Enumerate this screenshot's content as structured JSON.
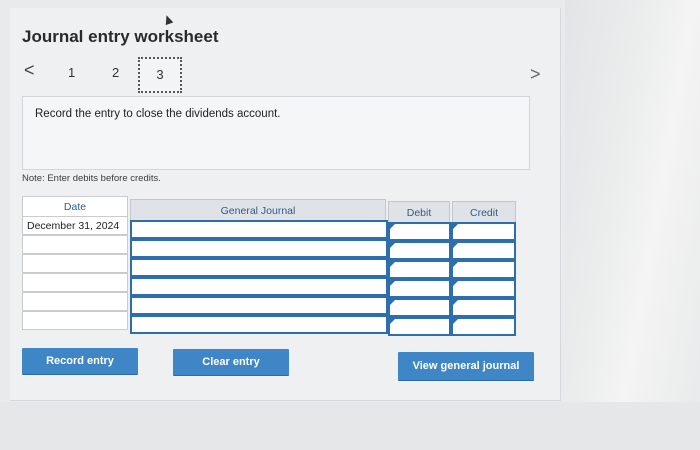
{
  "worksheet": {
    "title": "Journal entry worksheet",
    "pager": {
      "prev_icon": "chevron-left-icon",
      "next_icon": "chevron-right-icon",
      "prev_glyph": "<",
      "next_glyph": ">",
      "pages": [
        "1",
        "2",
        "3"
      ],
      "current": "3"
    },
    "instruction": "Record the entry to close the dividends account.",
    "note": "Note: Enter debits before credits."
  },
  "table": {
    "headers": {
      "date": "Date",
      "general_journal": "General Journal",
      "debit": "Debit",
      "credit": "Credit"
    },
    "rows": [
      {
        "date": "December 31, 2024",
        "account": "",
        "debit": "",
        "credit": ""
      },
      {
        "date": "",
        "account": "",
        "debit": "",
        "credit": ""
      },
      {
        "date": "",
        "account": "",
        "debit": "",
        "credit": ""
      },
      {
        "date": "",
        "account": "",
        "debit": "",
        "credit": ""
      },
      {
        "date": "",
        "account": "",
        "debit": "",
        "credit": ""
      },
      {
        "date": "",
        "account": "",
        "debit": "",
        "credit": ""
      }
    ]
  },
  "buttons": {
    "record_entry": "Record entry",
    "clear_entry": "Clear entry",
    "view_general_journal": "View general journal"
  },
  "colors": {
    "button_blue": "#3f86c7",
    "header_text": "#2f5c86",
    "cell_border": "#2d6fae"
  }
}
